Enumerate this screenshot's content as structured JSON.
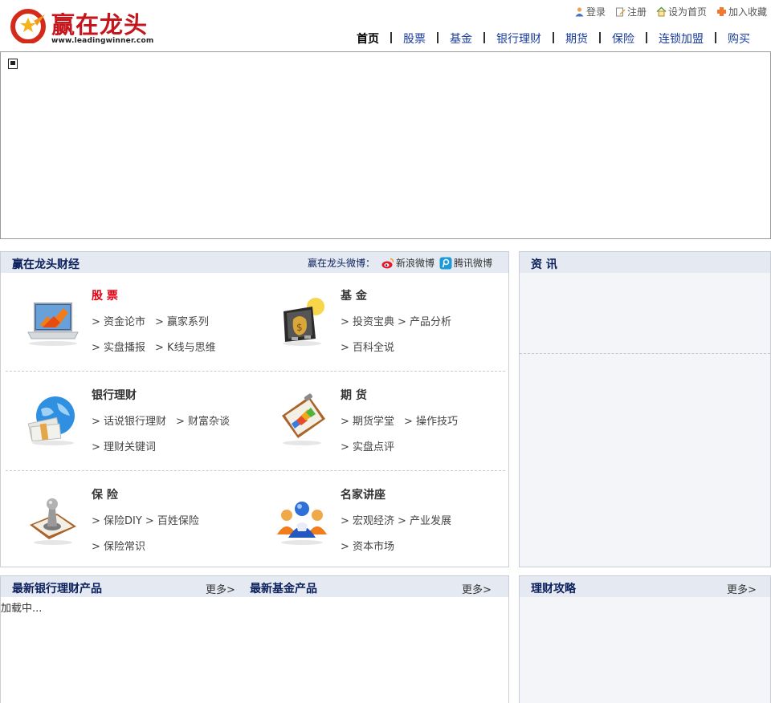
{
  "header": {
    "brand": "赢在龙头",
    "url": "www.leadingwinner.com",
    "top_links": [
      {
        "label": "登录",
        "icon": "user-icon"
      },
      {
        "label": "注册",
        "icon": "edit-icon"
      },
      {
        "label": "设为首页",
        "icon": "home-icon"
      },
      {
        "label": "加入收藏",
        "icon": "bookmark-icon"
      }
    ],
    "nav": [
      "首页",
      "股票",
      "基金",
      "银行理财",
      "期货",
      "保险",
      "连锁加盟",
      "购买"
    ]
  },
  "finance": {
    "title": "赢在龙头财经",
    "weibo_label": "赢在龙头微博：",
    "weibo_links": [
      "新浪微博",
      "腾讯微博"
    ],
    "categories": [
      {
        "name": "股 票",
        "icon": "laptop-chart-icon",
        "row1": [
          "> 资金论市",
          "> 赢家系列"
        ],
        "row2": [
          "> 实盘播报",
          "> K线与思维"
        ]
      },
      {
        "name": "基 金",
        "icon": "money-bag-icon",
        "row1": [
          "> 投资宝典",
          "> 产品分析"
        ],
        "row2": [
          "> 百科全说"
        ]
      },
      {
        "name": "银行理财",
        "icon": "globe-money-icon",
        "row1": [
          "> 话说银行理财",
          "> 财富杂谈"
        ],
        "row2": [
          "> 理财关键词"
        ]
      },
      {
        "name": "期 货",
        "icon": "clipboard-chart-icon",
        "row1": [
          "> 期货学堂",
          "> 操作技巧"
        ],
        "row2": [
          "> 实盘点评"
        ]
      },
      {
        "name": "保 险",
        "icon": "chess-pawn-icon",
        "row1": [
          "> 保险DIY",
          "> 百姓保险"
        ],
        "row2": [
          "> 保险常识"
        ]
      },
      {
        "name": "名家讲座",
        "icon": "people-group-icon",
        "row1": [
          "> 宏观经济",
          "> 产业发展"
        ],
        "row2": [
          "> 资本市场"
        ]
      }
    ]
  },
  "news": {
    "title": "资 讯"
  },
  "bank_products": {
    "title": "最新银行理财产品",
    "more": "更多>",
    "loading": "加载中..."
  },
  "fund_products": {
    "title": "最新基金产品",
    "more": "更多>"
  },
  "strategy": {
    "title": "理财攻略",
    "more": "更多>"
  },
  "colors": {
    "brand_red": "#c4161c",
    "nav_blue": "#1a3c9c",
    "panel_header": "#e4e9f2",
    "title_navy": "#0a1f5c"
  }
}
